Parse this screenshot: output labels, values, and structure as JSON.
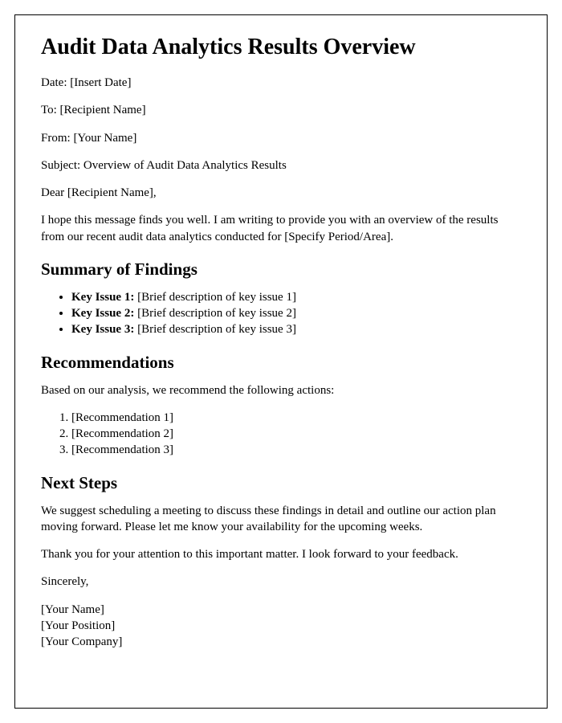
{
  "title": "Audit Data Analytics Results Overview",
  "meta": {
    "date_label": "Date: ",
    "date_value": "[Insert Date]",
    "to_label": "To: ",
    "to_value": "[Recipient Name]",
    "from_label": "From: ",
    "from_value": "[Your Name]",
    "subject_label": "Subject: ",
    "subject_value": "Overview of Audit Data Analytics Results"
  },
  "salutation": "Dear [Recipient Name],",
  "intro": "I hope this message finds you well. I am writing to provide you with an overview of the results from our recent audit data analytics conducted for [Specify Period/Area].",
  "findings": {
    "heading": "Summary of Findings",
    "items": [
      {
        "label": "Key Issue 1: ",
        "desc": "[Brief description of key issue 1]"
      },
      {
        "label": "Key Issue 2: ",
        "desc": "[Brief description of key issue 2]"
      },
      {
        "label": "Key Issue 3: ",
        "desc": "[Brief description of key issue 3]"
      }
    ]
  },
  "recommendations": {
    "heading": "Recommendations",
    "lead": "Based on our analysis, we recommend the following actions:",
    "items": [
      "[Recommendation 1]",
      "[Recommendation 2]",
      "[Recommendation 3]"
    ]
  },
  "next_steps": {
    "heading": "Next Steps",
    "body": "We suggest scheduling a meeting to discuss these findings in detail and outline our action plan moving forward. Please let me know your availability for the upcoming weeks."
  },
  "closing": "Thank you for your attention to this important matter. I look forward to your feedback.",
  "signoff": "Sincerely,",
  "signature": {
    "name": "[Your Name]",
    "position": "[Your Position]",
    "company": "[Your Company]"
  }
}
